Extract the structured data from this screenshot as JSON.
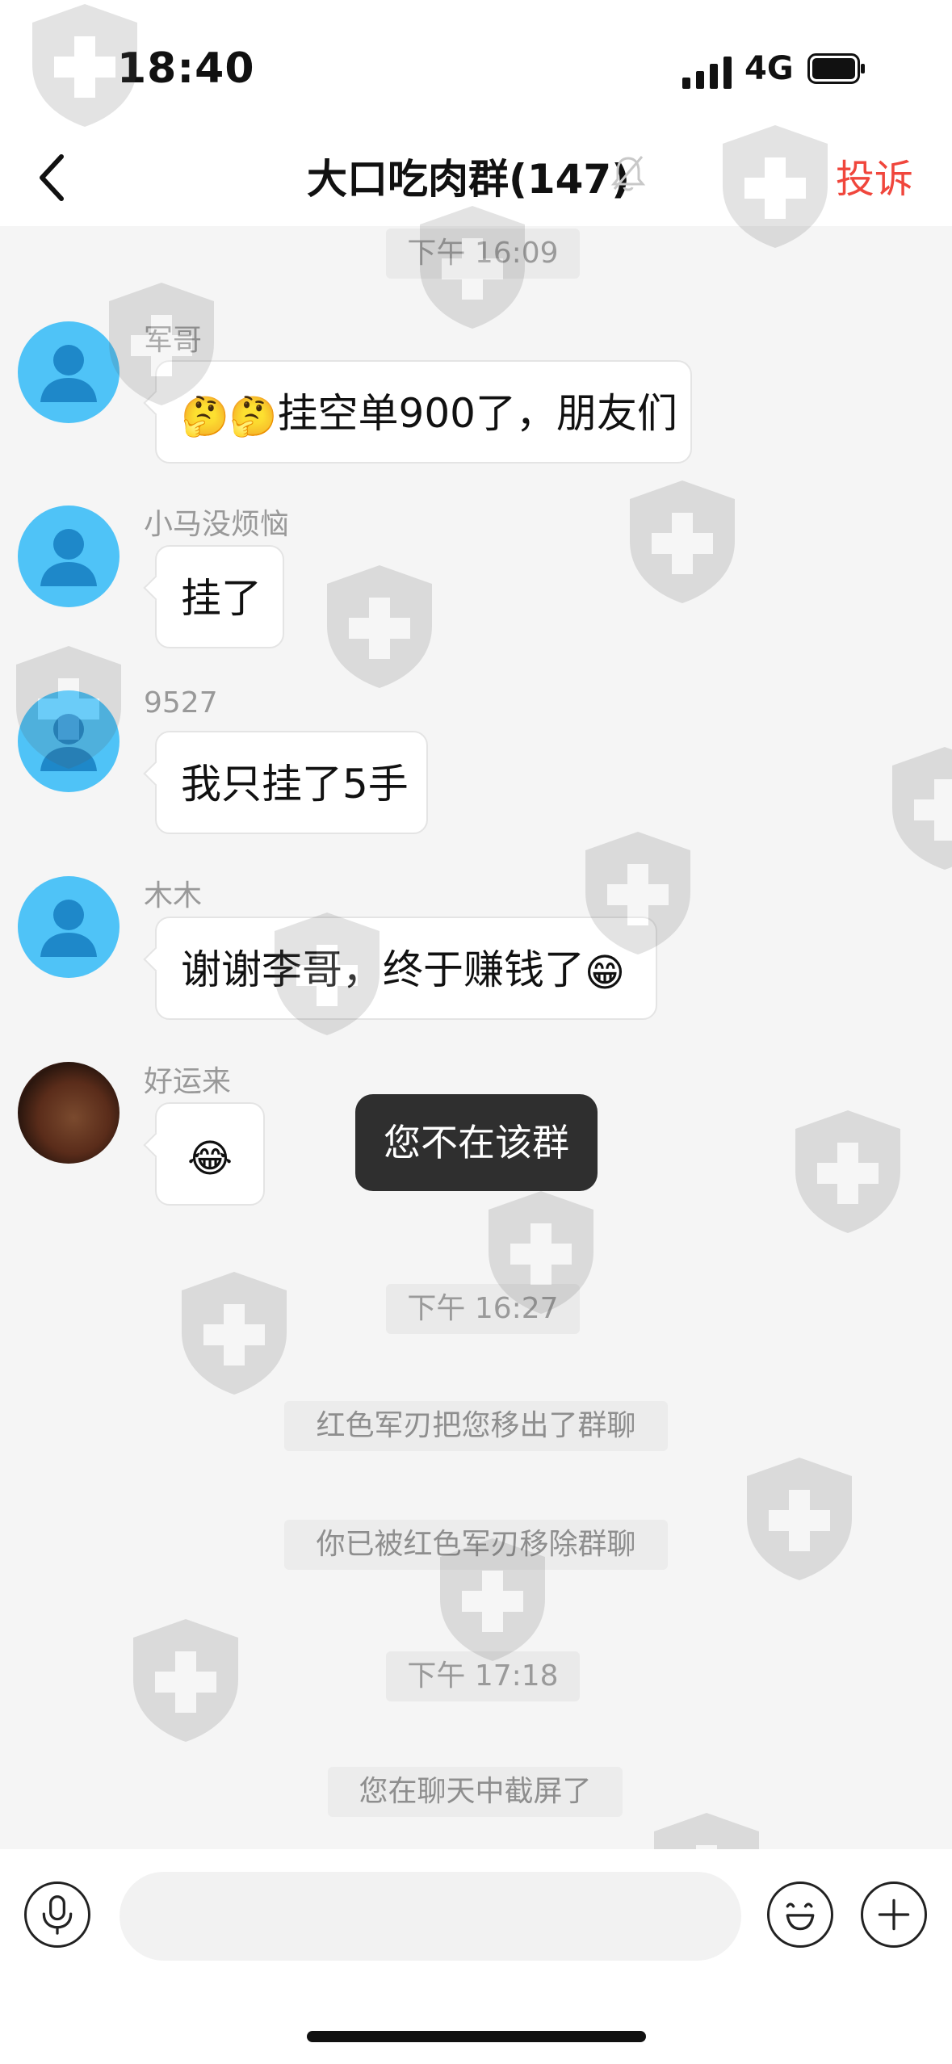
{
  "status": {
    "time": "18:40",
    "network": "4G"
  },
  "header": {
    "title": "大口吃肉群(147)",
    "complain": "投诉"
  },
  "messages": [
    {
      "sender": "军哥",
      "text": "挂空单900了，朋友们",
      "emoji_prefix": "🤔🤔"
    },
    {
      "sender": "小马没烦恼",
      "text": "挂了"
    },
    {
      "sender": "9527",
      "text": "我只挂了5手"
    },
    {
      "sender": "木木",
      "text": "谢谢李哥，终于赚钱了",
      "emoji_suffix": "😁"
    },
    {
      "sender": "好运来",
      "emoji": "😂"
    }
  ],
  "timestamps": [
    "下午 16:09",
    "下午 16:27",
    "下午 17:18"
  ],
  "system_messages": [
    "红色军刃把您移出了群聊",
    "你已被红色军刃移除群聊",
    "您在聊天中截屏了"
  ],
  "toast": "您不在该群",
  "input": {
    "placeholder": ""
  },
  "colors": {
    "accent_red": "#f0463c",
    "avatar_blue": "#4fc3f7",
    "background": "#f5f5f5"
  }
}
